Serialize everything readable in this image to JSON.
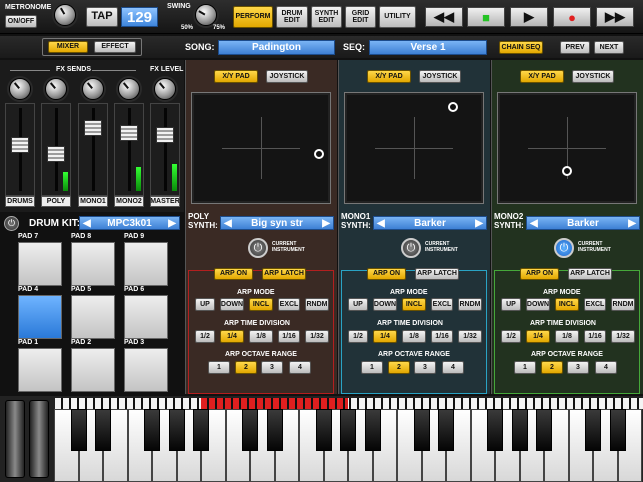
{
  "toolbar": {
    "metronome_label": "METRONOME",
    "onoff_label": "ON/OFF",
    "tap_label": "TAP",
    "bpm": "129",
    "swing_label": "SWING",
    "swing_min": "50%",
    "swing_max": "75%",
    "tabs": [
      "PERFORM",
      "DRUM EDIT",
      "SYNTH EDIT",
      "GRID EDIT",
      "UTILITY"
    ],
    "active_tab": "PERFORM",
    "transport": [
      {
        "name": "rewind",
        "glyph": "◀◀"
      },
      {
        "name": "stop",
        "glyph": "■"
      },
      {
        "name": "play",
        "glyph": "▶"
      },
      {
        "name": "record",
        "glyph": "●"
      },
      {
        "name": "fast-forward",
        "glyph": "▶▶"
      }
    ],
    "stop_color": "#24c324",
    "record_color": "#e01f1f"
  },
  "songbar": {
    "mixer_label": "MIXER",
    "effect_label": "EFFECT",
    "song_label": "SONG:",
    "song_value": "Padington",
    "seq_label": "SEQ:",
    "seq_value": "Verse 1",
    "chain_label": "CHAIN SEQ",
    "prev_label": "PREV",
    "next_label": "NEXT"
  },
  "mixer": {
    "fx_sends_label": "FX SENDS",
    "fx_level_label": "FX LEVEL",
    "channels": [
      {
        "label": "DRUMS",
        "level": 0.58,
        "meter": 0.0
      },
      {
        "label": "POLY",
        "level": 0.45,
        "meter": 0.22
      },
      {
        "label": "MONO1",
        "level": 0.82,
        "meter": 0.0
      },
      {
        "label": "MONO2",
        "level": 0.75,
        "meter": 0.28
      },
      {
        "label": "MASTER",
        "level": 0.72,
        "meter": 0.32
      }
    ]
  },
  "drumkit": {
    "label": "DRUM KIT:",
    "value": "MPC3k01",
    "pads": [
      "PAD 7",
      "PAD 8",
      "PAD 9",
      "PAD 4",
      "PAD 5",
      "PAD 6",
      "PAD 1",
      "PAD 2",
      "PAD 3"
    ],
    "selected_pad": "PAD 4"
  },
  "synths": [
    {
      "id": "poly",
      "xy_label": "X/Y PAD",
      "joystick_label": "JOYSTICK",
      "synth_label": "POLY\nSYNTH:",
      "patch": "Big syn str",
      "current_label": "CURRENT\nINSTRUMENT",
      "current_active": false,
      "arp_on_label": "ARP ON",
      "arp_latch_label": "ARP LATCH",
      "arp_latch_active": true,
      "arp_mode_label": "ARP MODE",
      "modes": [
        "UP",
        "DOWN",
        "INCL",
        "EXCL",
        "RNDM"
      ],
      "active_mode": "INCL",
      "time_label": "ARP TIME DIVISION",
      "divisions": [
        "1/2",
        "1/4",
        "1/8",
        "1/16",
        "1/32"
      ],
      "active_division": "1/4",
      "octave_label": "ARP OCTAVE RANGE",
      "octaves": [
        "1",
        "2",
        "3",
        "4"
      ],
      "active_octave": "2",
      "tint": "#3a2a24",
      "border": "#b31f1f",
      "xy_x": 0.92,
      "xy_y": 0.55
    },
    {
      "id": "mono1",
      "xy_label": "X/Y PAD",
      "joystick_label": "JOYSTICK",
      "synth_label": "MONO1\nSYNTH:",
      "patch": "Barker",
      "current_label": "CURRENT\nINSTRUMENT",
      "current_active": false,
      "arp_on_label": "ARP ON",
      "arp_latch_label": "ARP LATCH",
      "arp_latch_active": false,
      "arp_mode_label": "ARP MODE",
      "modes": [
        "UP",
        "DOWN",
        "INCL",
        "EXCL",
        "RNDM"
      ],
      "active_mode": "INCL",
      "time_label": "ARP TIME DIVISION",
      "divisions": [
        "1/2",
        "1/4",
        "1/8",
        "1/16",
        "1/32"
      ],
      "active_division": "1/4",
      "octave_label": "ARP OCTAVE RANGE",
      "octaves": [
        "1",
        "2",
        "3",
        "4"
      ],
      "active_octave": "2",
      "tint": "#213238",
      "border": "#2aa3c4",
      "xy_x": 0.78,
      "xy_y": 0.13
    },
    {
      "id": "mono2",
      "xy_label": "X/Y PAD",
      "joystick_label": "JOYSTICK",
      "synth_label": "MONO2\nSYNTH:",
      "patch": "Barker",
      "current_label": "CURRENT\nINSTRUMENT",
      "current_active": true,
      "arp_on_label": "ARP ON",
      "arp_latch_label": "ARP LATCH",
      "arp_latch_active": false,
      "arp_mode_label": "ARP MODE",
      "modes": [
        "UP",
        "DOWN",
        "INCL",
        "EXCL",
        "RNDM"
      ],
      "active_mode": "INCL",
      "time_label": "ARP TIME DIVISION",
      "divisions": [
        "1/2",
        "1/4",
        "1/8",
        "1/16",
        "1/32"
      ],
      "active_division": "1/4",
      "octave_label": "ARP OCTAVE RANGE",
      "octaves": [
        "1",
        "2",
        "3",
        "4"
      ],
      "active_octave": "2",
      "tint": "#22321f",
      "border": "#46a83a",
      "xy_x": 0.5,
      "xy_y": 0.71
    }
  ],
  "keyboard": {
    "octaves": 3,
    "highlight_color": "#e01f1f"
  }
}
